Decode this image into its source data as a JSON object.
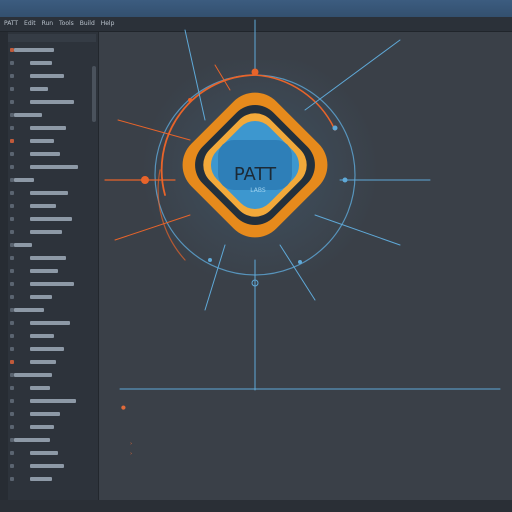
{
  "window": {
    "title": ""
  },
  "menu": [
    "PATT",
    "Edit",
    "Run",
    "Tools",
    "Build",
    "Help"
  ],
  "logo": {
    "title": "PATT",
    "subtitle": "LABS"
  },
  "colors": {
    "accent_orange": "#e8642a",
    "accent_blue": "#5fa9d8",
    "panel": "#2d333b",
    "canvas": "#3a4048"
  },
  "sidebar": {
    "rows": 34
  },
  "log": {
    "caption": "",
    "lines": [
      {
        "text": ""
      },
      {
        "text": ""
      }
    ]
  }
}
